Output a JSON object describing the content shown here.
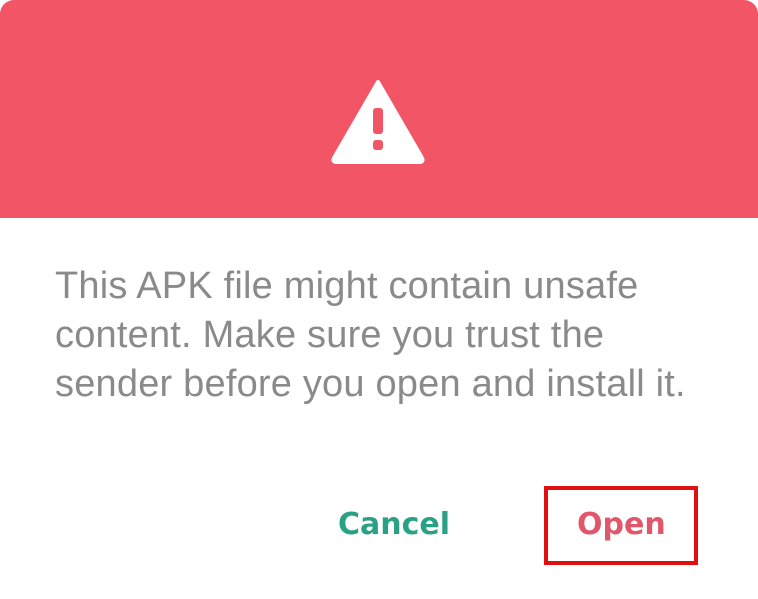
{
  "dialog": {
    "header_color": "#f25566",
    "icon": "warning-triangle-icon",
    "message": "This APK file might contain unsafe content. Make sure you trust the sender before you open and install it.",
    "buttons": {
      "cancel_label": "Cancel",
      "open_label": "Open"
    },
    "accent_colors": {
      "cancel": "#2aa184",
      "open": "#e0566b",
      "highlight": "#e01010"
    }
  }
}
